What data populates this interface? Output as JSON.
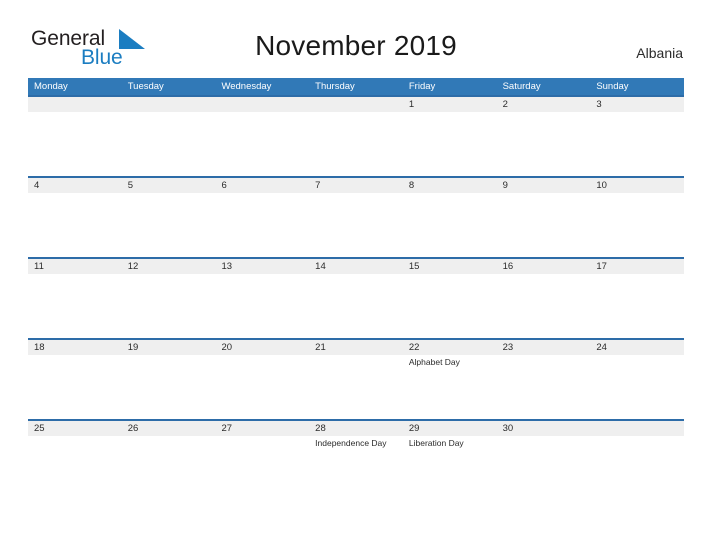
{
  "brand": {
    "name_top": "General",
    "name_bottom": "Blue",
    "accent_color": "#1b7dc1",
    "logo_icon": "triangle-flag-icon"
  },
  "header": {
    "title": "November 2019",
    "region": "Albania"
  },
  "theme": {
    "header_blue": "#3179b7",
    "band_gray": "#efefef",
    "band_border": "#2d6ca8",
    "text_dark": "#2b2b2b"
  },
  "calendar": {
    "weekdays": [
      "Monday",
      "Tuesday",
      "Wednesday",
      "Thursday",
      "Friday",
      "Saturday",
      "Sunday"
    ],
    "weeks": [
      {
        "days": [
          {
            "num": "",
            "event": ""
          },
          {
            "num": "",
            "event": ""
          },
          {
            "num": "",
            "event": ""
          },
          {
            "num": "",
            "event": ""
          },
          {
            "num": "1",
            "event": ""
          },
          {
            "num": "2",
            "event": ""
          },
          {
            "num": "3",
            "event": ""
          }
        ]
      },
      {
        "days": [
          {
            "num": "4",
            "event": ""
          },
          {
            "num": "5",
            "event": ""
          },
          {
            "num": "6",
            "event": ""
          },
          {
            "num": "7",
            "event": ""
          },
          {
            "num": "8",
            "event": ""
          },
          {
            "num": "9",
            "event": ""
          },
          {
            "num": "10",
            "event": ""
          }
        ]
      },
      {
        "days": [
          {
            "num": "11",
            "event": ""
          },
          {
            "num": "12",
            "event": ""
          },
          {
            "num": "13",
            "event": ""
          },
          {
            "num": "14",
            "event": ""
          },
          {
            "num": "15",
            "event": ""
          },
          {
            "num": "16",
            "event": ""
          },
          {
            "num": "17",
            "event": ""
          }
        ]
      },
      {
        "days": [
          {
            "num": "18",
            "event": ""
          },
          {
            "num": "19",
            "event": ""
          },
          {
            "num": "20",
            "event": ""
          },
          {
            "num": "21",
            "event": ""
          },
          {
            "num": "22",
            "event": "Alphabet Day"
          },
          {
            "num": "23",
            "event": ""
          },
          {
            "num": "24",
            "event": ""
          }
        ]
      },
      {
        "days": [
          {
            "num": "25",
            "event": ""
          },
          {
            "num": "26",
            "event": ""
          },
          {
            "num": "27",
            "event": ""
          },
          {
            "num": "28",
            "event": "Independence Day"
          },
          {
            "num": "29",
            "event": "Liberation Day"
          },
          {
            "num": "30",
            "event": ""
          },
          {
            "num": "",
            "event": ""
          }
        ]
      }
    ]
  }
}
